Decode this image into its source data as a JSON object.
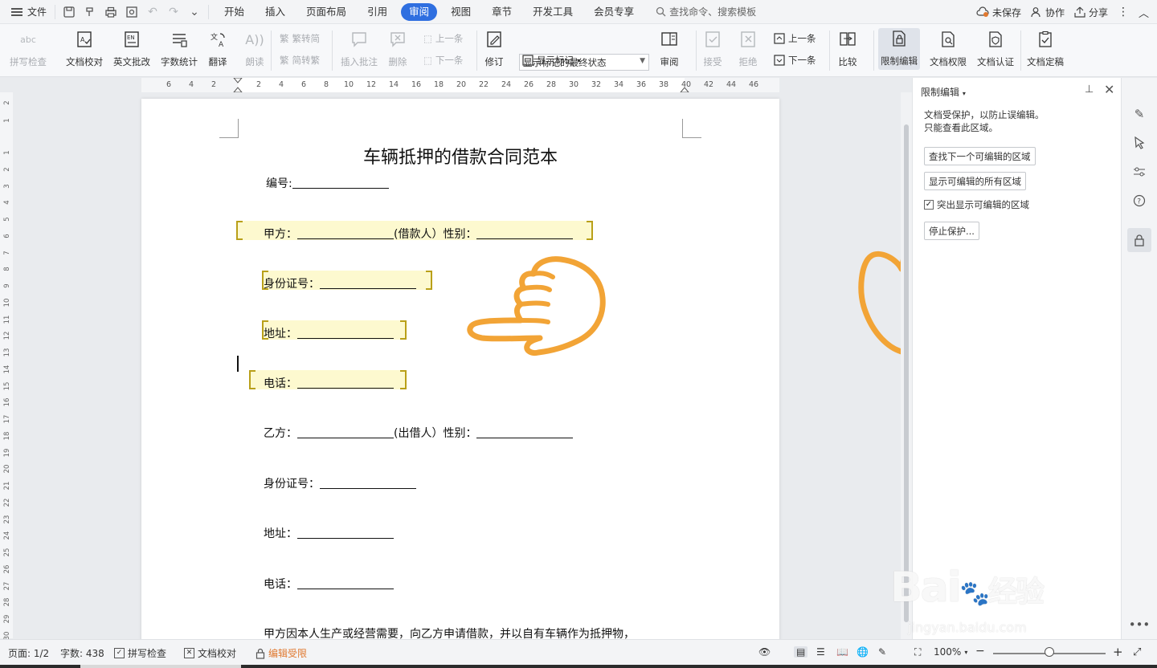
{
  "menubar": {
    "file": "文件",
    "tabs": [
      "开始",
      "插入",
      "页面布局",
      "引用",
      "审阅",
      "视图",
      "章节",
      "开发工具",
      "会员专享"
    ],
    "active_tab": "审阅",
    "search": "查找命令、搜索模板",
    "unsaved": "未保存",
    "collab": "协作",
    "share": "分享"
  },
  "ribbon": {
    "spell_check": "拼写检查",
    "doc_proofread": "文档校对",
    "en_review": "英文批改",
    "word_count": "字数统计",
    "translate": "翻译",
    "read_aloud": "朗读",
    "trad_to_simp": "繁转简",
    "simp_to_trad": "简转繁",
    "insert_comment": "插入批注",
    "delete": "删除",
    "prev_comment": "上一条",
    "next_comment": "下一条",
    "revise": "修订",
    "markup_state": "显示标记的最终状态",
    "show_markup": "显示标记",
    "review": "审阅",
    "accept": "接受",
    "reject": "拒绝",
    "prev_change": "上一条",
    "next_change": "下一条",
    "compare": "比较",
    "restrict_edit": "限制编辑",
    "doc_permission": "文档权限",
    "doc_cert": "文档认证",
    "doc_finalize": "文档定稿"
  },
  "ruler": {
    "h_numbers": [
      "6",
      "4",
      "2",
      "2",
      "4",
      "6",
      "8",
      "10",
      "12",
      "14",
      "16",
      "18",
      "20",
      "22",
      "24",
      "26",
      "28",
      "30",
      "32",
      "34",
      "36",
      "38",
      "40",
      "42",
      "44",
      "46"
    ],
    "v_numbers": [
      "2",
      "1",
      "1",
      "2",
      "3",
      "4",
      "5",
      "6",
      "7",
      "8",
      "9",
      "10",
      "11",
      "12",
      "13",
      "14",
      "15",
      "16",
      "17",
      "18",
      "19",
      "20",
      "21",
      "22",
      "23",
      "24",
      "25",
      "26",
      "27",
      "28",
      "29",
      "30"
    ]
  },
  "document": {
    "title": "车辆抵押的借款合同范本",
    "serial_label": "编号:",
    "party_a": "甲方：",
    "borrower_tag": "(借款人）性别：",
    "id_label": "身份证号：",
    "address_label": "地址：",
    "phone_label": "电话：",
    "party_b": "乙方：",
    "lender_tag": "(出借人）性别：",
    "body_start": "甲方因本人生产或经营需要，向乙方申请借款，并以自有车辆作为抵押物，"
  },
  "pane": {
    "title": "限制编辑",
    "desc_line1": "文档受保护，以防止误编辑。",
    "desc_line2": "只能查看此区域。",
    "find_next": "查找下一个可编辑的区域",
    "show_all": "显示可编辑的所有区域",
    "highlight_label": "突出显示可编辑的区域",
    "highlight_checked": true,
    "stop_protect": "停止保护..."
  },
  "status": {
    "page": "页面: 1/2",
    "words": "字数: 438",
    "spell": "拼写检查",
    "proof": "文档校对",
    "restricted": "编辑受限",
    "zoom": "100%"
  },
  "colors": {
    "accent": "#2f6fe0",
    "highlight_fill": "#fdf9cf",
    "highlight_bracket": "#b9a019",
    "hand_stroke": "#f2a436",
    "warn": "#e0782f"
  },
  "watermark": {
    "brand": "Bai",
    "brand_cn": "经验",
    "url": "jingyan.baidu.com"
  }
}
